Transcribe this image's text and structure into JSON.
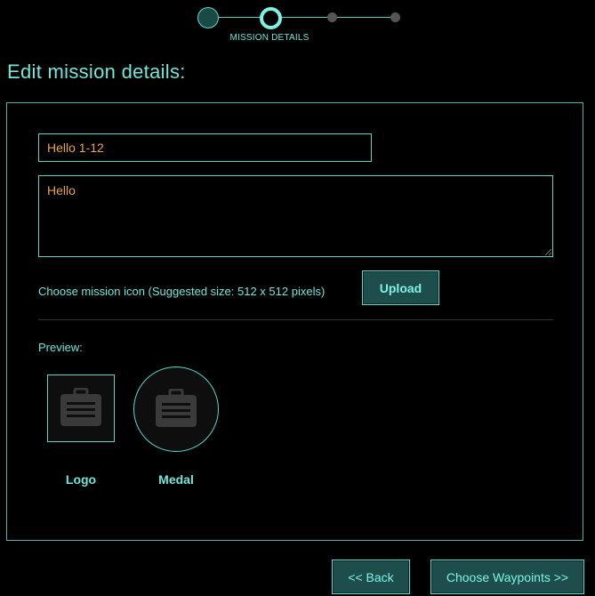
{
  "stepper": {
    "steps": [
      "",
      "MISSION DETAILS",
      "",
      ""
    ],
    "current_label": "MISSION DETAILS",
    "current_index": 1
  },
  "title": "Edit mission details:",
  "form": {
    "name_value": "Hello 1-12",
    "description_value": "Hello",
    "icon_label": "Choose mission icon (Suggested size: 512 x 512 pixels)",
    "upload_label": "Upload"
  },
  "preview": {
    "label": "Preview:",
    "logo_caption": "Logo",
    "medal_caption": "Medal",
    "placeholder_icon": "briefcase-icon"
  },
  "footer": {
    "back_label": "<< Back",
    "next_label": "Choose Waypoints >>"
  },
  "colors": {
    "background": "#000000",
    "accent": "#6fe8dc",
    "border": "#59d6ca",
    "input_text": "#e8a44d",
    "button_fill": "#1e4e4b",
    "inactive_step": "#555555"
  }
}
